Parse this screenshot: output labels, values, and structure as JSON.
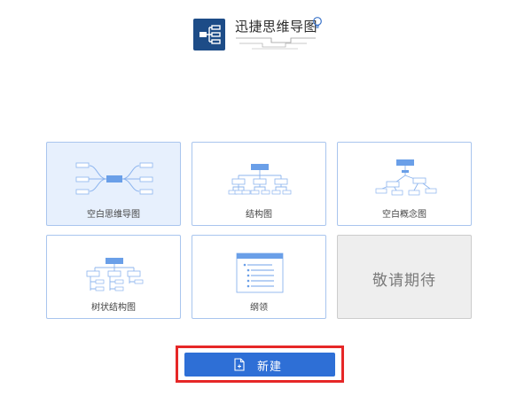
{
  "app": {
    "title": "迅捷思维导图",
    "logo_color": "#1d4c87",
    "accent_color": "#2e6fd6"
  },
  "templates": [
    {
      "label": "空白思维导图",
      "icon": "mindmap-icon",
      "selected": true
    },
    {
      "label": "结构图",
      "icon": "org-chart-icon"
    },
    {
      "label": "空白概念图",
      "icon": "concept-map-icon"
    },
    {
      "label": "树状结构图",
      "icon": "tree-chart-icon"
    },
    {
      "label": "纲领",
      "icon": "outline-icon"
    },
    {
      "label": "敬请期待",
      "icon": "none",
      "disabled": true
    }
  ],
  "actions": {
    "new_label": "新建",
    "new_icon": "new-document-icon"
  }
}
